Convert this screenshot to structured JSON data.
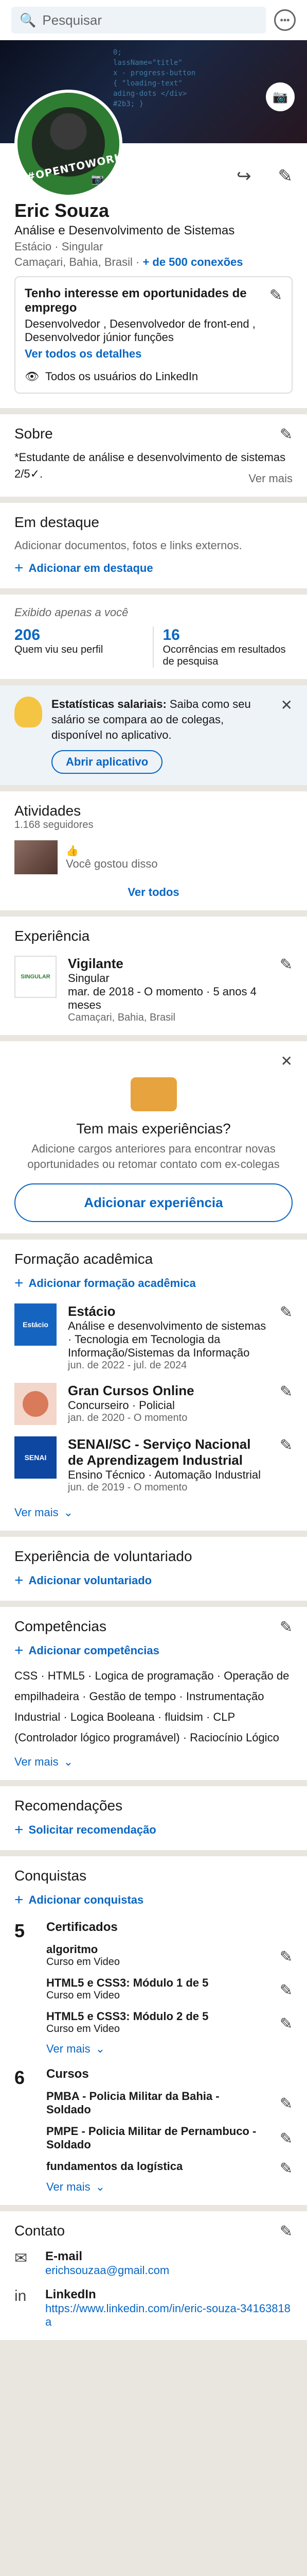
{
  "topbar": {
    "search_placeholder": "Pesquisar"
  },
  "profile": {
    "badge": "#OPENTOWORK",
    "name": "Eric Souza",
    "headline": "Análise e Desenvolvimento de Sistemas",
    "company": "Estácio · Singular",
    "location": "Camaçari, Bahia, Brasil",
    "connections": "+ de 500 conexões",
    "opentowork": {
      "title": "Tenho interesse em oportunidades de emprego",
      "desc": "Desenvolvedor , Desenvolvedor de front-end , Desenvolvedor júnior funções",
      "details": "Ver todos os detalhes",
      "visibility": "Todos os usuários do LinkedIn"
    }
  },
  "about": {
    "title": "Sobre",
    "text": "*Estudante de análise e desenvolvimento de sistemas 2/5✓.",
    "more": "Ver mais"
  },
  "featured": {
    "title": "Em destaque",
    "text": "Adicionar documentos, fotos e links externos.",
    "add": "Adicionar em destaque"
  },
  "analytics": {
    "label": "Exibido apenas a você",
    "views_num": "206",
    "views_label": "Quem viu seu perfil",
    "search_num": "16",
    "search_label": "Ocorrências em resultados de pesquisa"
  },
  "salary": {
    "bold": "Estatísticas salariais:",
    "text": " Saiba como seu salário se compara ao de colegas, disponível no aplicativo.",
    "button": "Abrir aplicativo"
  },
  "activity": {
    "title": "Atividades",
    "followers": "1.168 seguidores",
    "post": "Você gostou disso",
    "see_all": "Ver todos"
  },
  "experience": {
    "title": "Experiência",
    "role": "Vigilante",
    "company": "Singular",
    "dates": "mar. de 2018 - O momento · 5 anos 4 meses",
    "location": "Camaçari, Bahia, Brasil",
    "logo_text": "SINGULAR"
  },
  "more_exp": {
    "title": "Tem mais experiências?",
    "text": "Adicione cargos anteriores para encontrar novas oportunidades ou retomar contato com ex-colegas",
    "button": "Adicionar experiência"
  },
  "education": {
    "title": "Formação acadêmica",
    "add": "Adicionar formação acadêmica",
    "items": [
      {
        "logo": "Estácio",
        "name": "Estácio",
        "degree": "Análise e desenvolvimento de sistemas · Tecnologia em Tecnologia da Informação/Sistemas da Informação",
        "dates": "jun. de 2022 - jul. de 2024"
      },
      {
        "logo": "",
        "name": "Gran Cursos Online",
        "degree": "Concurseiro · Policial",
        "dates": "jan. de 2020 - O momento"
      },
      {
        "logo": "SENAI",
        "name": "SENAI/SC - Serviço Nacional de Aprendizagem Industrial",
        "degree": "Ensino Técnico · Automação Industrial",
        "dates": "jun. de 2019 - O momento"
      }
    ],
    "more": "Ver mais"
  },
  "volunteer": {
    "title": "Experiência de voluntariado",
    "add": "Adicionar voluntariado"
  },
  "skills": {
    "title": "Competências",
    "add": "Adicionar competências",
    "list": "CSS · HTML5 · Logica de programação · Operação de empilhadeira · Gestão de tempo · Instrumentação Industrial · Logica Booleana · fluidsim · CLP (Controlador lógico programável) · Raciocínio Lógico",
    "more": "Ver mais"
  },
  "recommend": {
    "title": "Recomendações",
    "add": "Solicitar recomendação"
  },
  "achievements": {
    "title": "Conquistas",
    "add": "Adicionar conquistas",
    "certs": {
      "count": "5",
      "label": "Certificados",
      "items": [
        {
          "t": "algoritmo",
          "s": "Curso em Video"
        },
        {
          "t": "HTML5 e CSS3: Módulo 1 de 5",
          "s": "Curso em Video"
        },
        {
          "t": "HTML5 e CSS3: Módulo 2 de 5",
          "s": "Curso em Video"
        }
      ],
      "more": "Ver mais"
    },
    "courses": {
      "count": "6",
      "label": "Cursos",
      "items": [
        {
          "t": "PMBA - Policia Militar da Bahia - Soldado"
        },
        {
          "t": "PMPE - Policia Militar de Pernambuco - Soldado"
        },
        {
          "t": "fundamentos da logística"
        }
      ],
      "more": "Ver mais"
    }
  },
  "contact": {
    "title": "Contato",
    "email_label": "E-mail",
    "email": "erichsouzaa@gmail.com",
    "li_label": "LinkedIn",
    "li": "https://www.linkedin.com/in/eric-souza-34163818a"
  }
}
